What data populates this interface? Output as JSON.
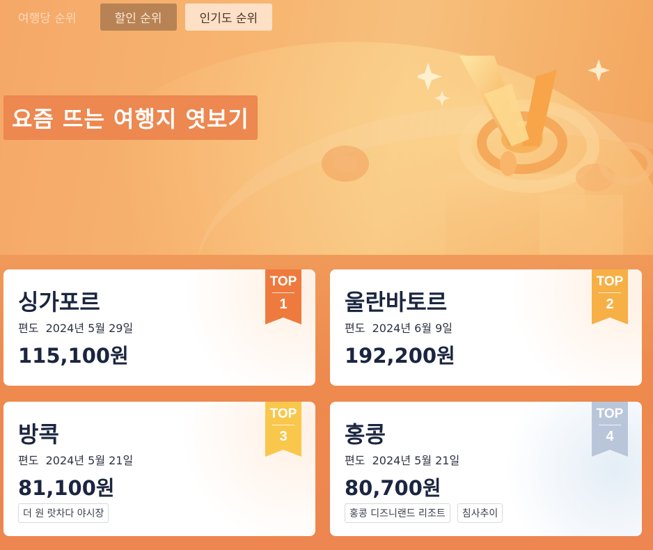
{
  "tabs": [
    {
      "label": "여행당 순위"
    },
    {
      "label": "할인 순위"
    },
    {
      "label": "인기도 순위"
    }
  ],
  "banner": {
    "title": "요즘 뜨는 여행지 엿보기"
  },
  "cards": [
    {
      "city": "싱가포르",
      "date": "편도  2024년 5월 29일",
      "price": "115,100원",
      "rank_label": "TOP",
      "rank": "1",
      "ribbon_color": "#ef7a3e",
      "tags": []
    },
    {
      "city": "울란바토르",
      "date": "편도  2024년 6월 9일",
      "price": "192,200원",
      "rank_label": "TOP",
      "rank": "2",
      "ribbon_color": "#f7b045",
      "tags": []
    },
    {
      "city": "방콕",
      "date": "편도  2024년 5월 21일",
      "price": "81,100원",
      "rank_label": "TOP",
      "rank": "3",
      "ribbon_color": "#f8c74c",
      "tags": [
        "더 원 랏차다 야시장"
      ]
    },
    {
      "city": "홍콩",
      "date": "편도  2024년 5월 21일",
      "price": "80,700원",
      "rank_label": "TOP",
      "rank": "4",
      "ribbon_color": "#b9c6da",
      "tags": [
        "홍콩 디즈니랜드 리조트",
        "침사추이"
      ]
    }
  ]
}
